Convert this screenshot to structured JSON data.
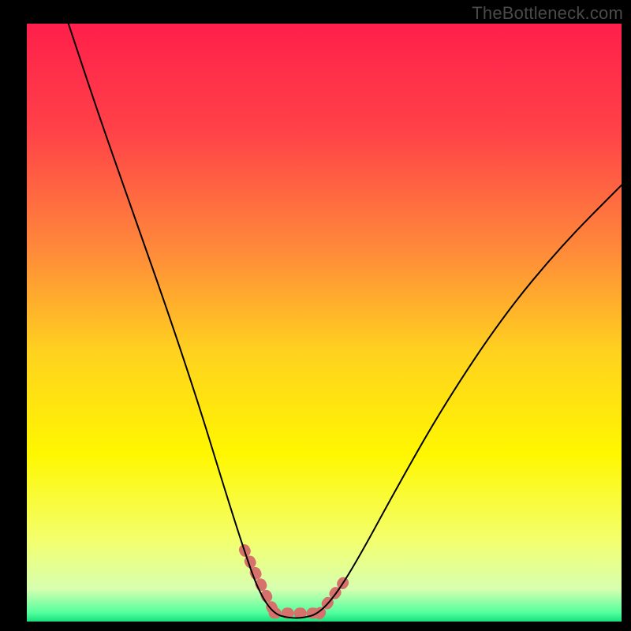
{
  "watermark": "TheBottleneck.com",
  "plot": {
    "inner_x": 34,
    "inner_y": 30,
    "inner_w": 754,
    "inner_h": 758,
    "frame_stroke": "#000000"
  },
  "chart_data": {
    "type": "line",
    "title": "",
    "xlabel": "",
    "ylabel": "",
    "xlim": [
      0,
      100
    ],
    "ylim": [
      0,
      100
    ],
    "curve": [
      {
        "x": 7.0,
        "y": 100.0
      },
      {
        "x": 12.0,
        "y": 85.0
      },
      {
        "x": 18.0,
        "y": 68.0
      },
      {
        "x": 24.0,
        "y": 51.0
      },
      {
        "x": 29.0,
        "y": 36.0
      },
      {
        "x": 33.0,
        "y": 23.0
      },
      {
        "x": 36.5,
        "y": 12.0
      },
      {
        "x": 39.0,
        "y": 5.0
      },
      {
        "x": 41.5,
        "y": 1.3
      },
      {
        "x": 44.0,
        "y": 0.6
      },
      {
        "x": 46.5,
        "y": 0.6
      },
      {
        "x": 49.0,
        "y": 1.3
      },
      {
        "x": 52.0,
        "y": 4.5
      },
      {
        "x": 56.0,
        "y": 11.0
      },
      {
        "x": 62.0,
        "y": 22.0
      },
      {
        "x": 70.0,
        "y": 36.0
      },
      {
        "x": 80.0,
        "y": 51.0
      },
      {
        "x": 90.0,
        "y": 63.0
      },
      {
        "x": 100.0,
        "y": 73.0
      }
    ],
    "highlight_segments": [
      {
        "x0": 36.6,
        "y0": 12.0,
        "x1": 41.7,
        "y1": 1.3
      },
      {
        "x0": 49.2,
        "y0": 1.3,
        "x1": 53.2,
        "y1": 6.5
      }
    ],
    "bottom_band": {
      "y0": 0.0,
      "y1": 1.3
    },
    "gradient_stops": [
      {
        "offset": 0.0,
        "color": "#ff1f4b"
      },
      {
        "offset": 0.18,
        "color": "#ff4248"
      },
      {
        "offset": 0.38,
        "color": "#ff8a3a"
      },
      {
        "offset": 0.55,
        "color": "#ffd21f"
      },
      {
        "offset": 0.72,
        "color": "#fff700"
      },
      {
        "offset": 0.86,
        "color": "#f4ff6a"
      },
      {
        "offset": 0.945,
        "color": "#d8ffb0"
      },
      {
        "offset": 0.985,
        "color": "#54ff9e"
      },
      {
        "offset": 1.0,
        "color": "#18e07e"
      }
    ],
    "highlight_color": "#d6716b",
    "curve_color": "#000000"
  }
}
